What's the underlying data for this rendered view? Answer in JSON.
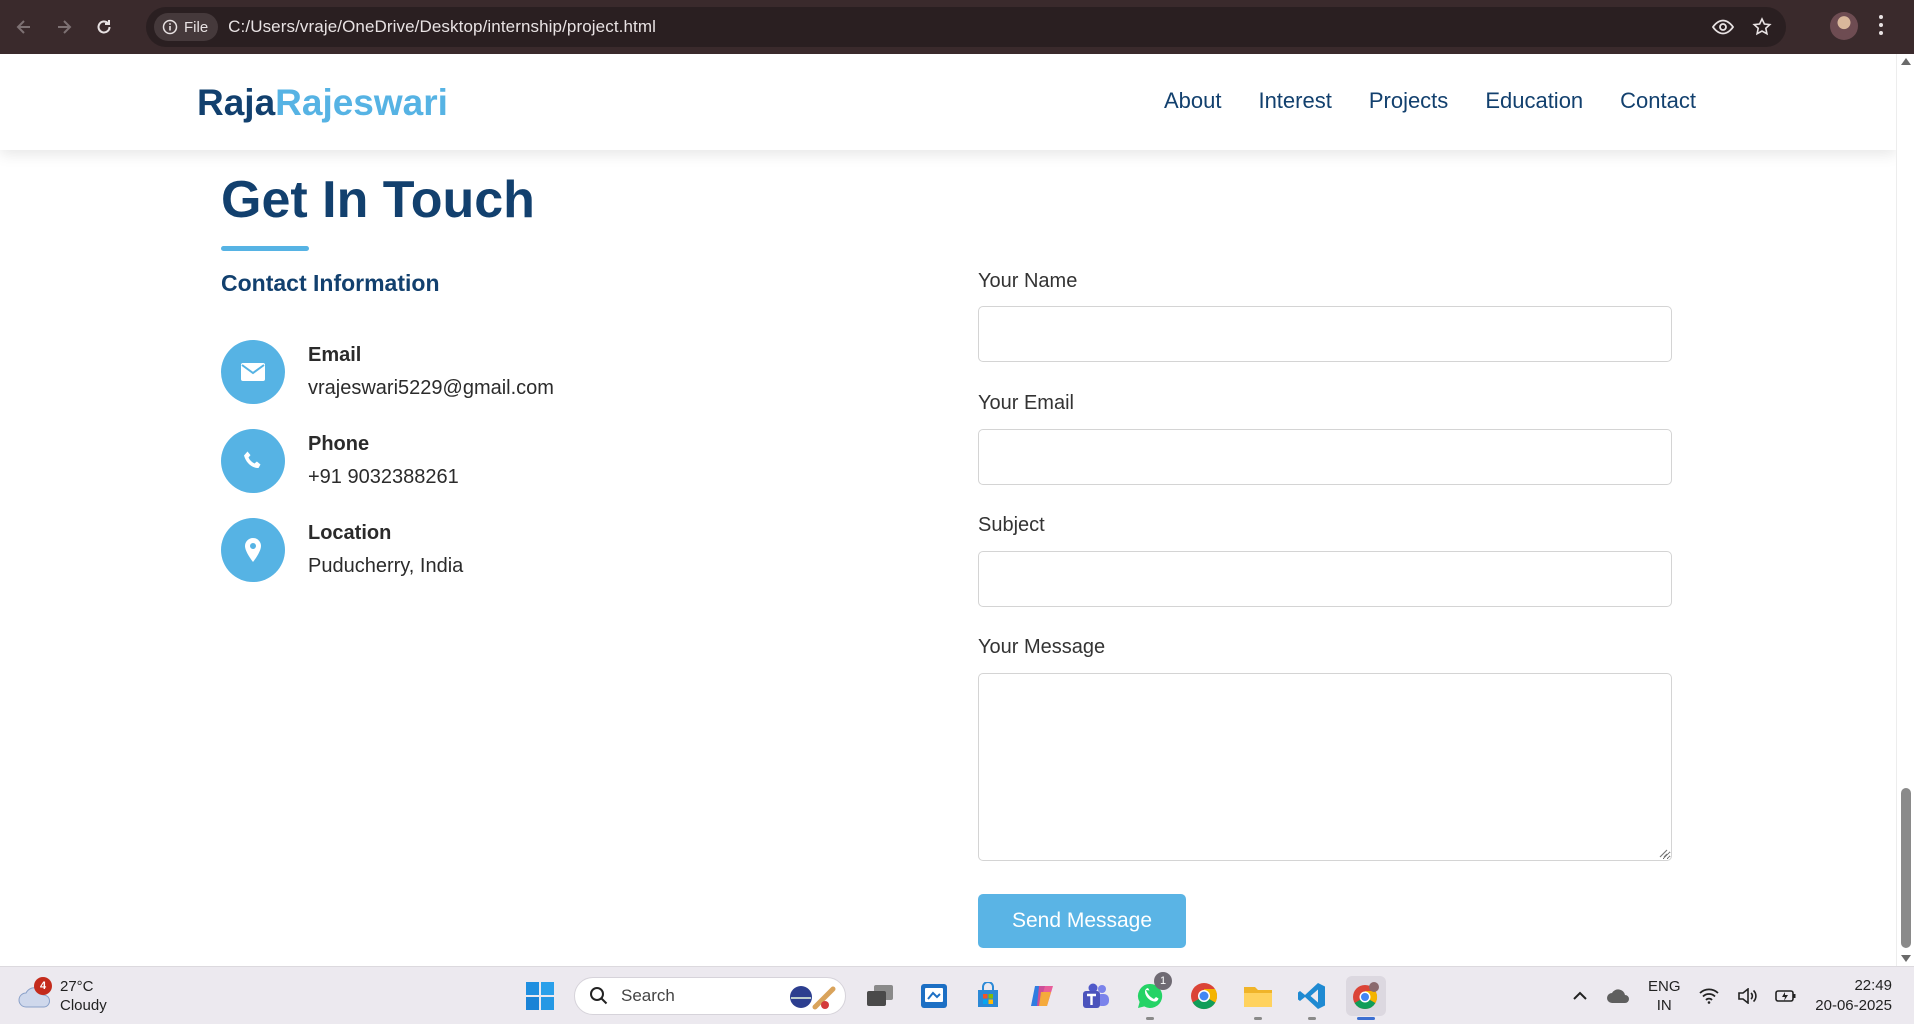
{
  "browser": {
    "file_chip": "File",
    "url": "C:/Users/vraje/OneDrive/Desktop/internship/project.html"
  },
  "site": {
    "logo_part1": "Raja",
    "logo_part2": "Rajeswari",
    "nav": [
      "About",
      "Interest",
      "Projects",
      "Education",
      "Contact"
    ]
  },
  "contact": {
    "title": "Get In Touch",
    "info_heading": "Contact Information",
    "items": [
      {
        "label": "Email",
        "value": "vrajeswari5229@gmail.com",
        "icon": "envelope-icon"
      },
      {
        "label": "Phone",
        "value": "+91 9032388261",
        "icon": "phone-icon"
      },
      {
        "label": "Location",
        "value": "Puducherry, India",
        "icon": "location-pin-icon"
      }
    ]
  },
  "form": {
    "name_label": "Your Name",
    "name_value": "",
    "email_label": "Your Email",
    "email_value": "",
    "subject_label": "Subject",
    "subject_value": "",
    "message_label": "Your Message",
    "message_value": "",
    "submit_label": "Send Message"
  },
  "colors": {
    "navy": "#12406e",
    "accent": "#56b3e4",
    "browser_bar": "#3a2a2c"
  },
  "taskbar": {
    "weather_temp": "27°C",
    "weather_desc": "Cloudy",
    "weather_badge": "4",
    "search_placeholder": "Search",
    "whatsapp_badge": "1",
    "lang_line1": "ENG",
    "lang_line2": "IN",
    "time": "22:49",
    "date": "20-06-2025"
  }
}
